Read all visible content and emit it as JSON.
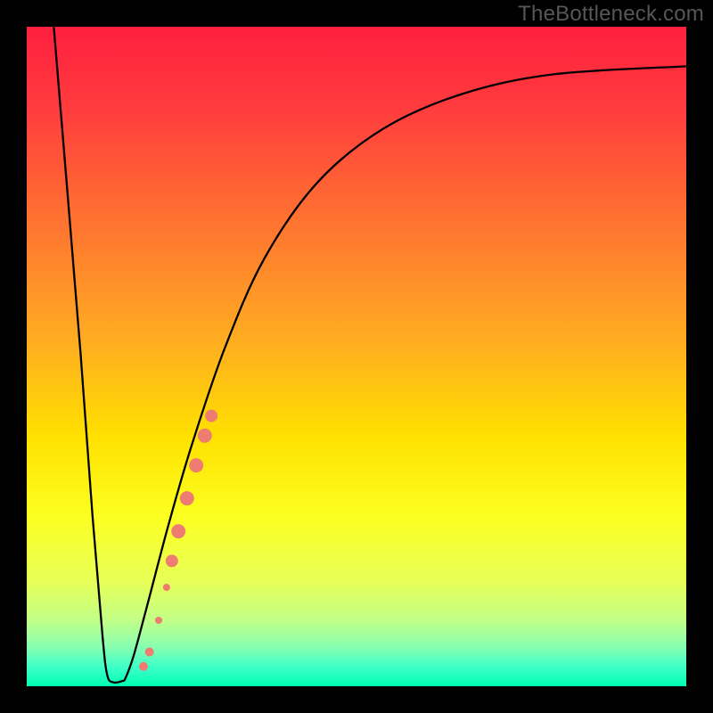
{
  "watermark": "TheBottleneck.com",
  "chart_data": {
    "type": "line",
    "title": "",
    "xlabel": "",
    "ylabel": "",
    "xlim": [
      0,
      100
    ],
    "ylim": [
      0,
      100
    ],
    "grid": false,
    "legend": false,
    "background_gradient_stops": [
      {
        "offset": 0.0,
        "color": "#ff1f3f"
      },
      {
        "offset": 0.12,
        "color": "#ff3b3e"
      },
      {
        "offset": 0.3,
        "color": "#ff7430"
      },
      {
        "offset": 0.48,
        "color": "#ffae20"
      },
      {
        "offset": 0.62,
        "color": "#ffe000"
      },
      {
        "offset": 0.74,
        "color": "#fcff20"
      },
      {
        "offset": 0.84,
        "color": "#e7ff56"
      },
      {
        "offset": 0.9,
        "color": "#c2ff87"
      },
      {
        "offset": 0.94,
        "color": "#88ffb0"
      },
      {
        "offset": 0.97,
        "color": "#40ffc8"
      },
      {
        "offset": 1.0,
        "color": "#00ffb4"
      }
    ],
    "series": [
      {
        "name": "bottleneck-curve",
        "color": "#000000",
        "points": [
          {
            "x": 4.1,
            "y": 100.0
          },
          {
            "x": 8.2,
            "y": 50.0
          },
          {
            "x": 10.0,
            "y": 25.5
          },
          {
            "x": 11.5,
            "y": 7.5
          },
          {
            "x": 12.2,
            "y": 1.7
          },
          {
            "x": 13.1,
            "y": 0.6
          },
          {
            "x": 14.5,
            "y": 0.8
          },
          {
            "x": 15.0,
            "y": 1.3
          },
          {
            "x": 16.2,
            "y": 4.6
          },
          {
            "x": 18.2,
            "y": 12.0
          },
          {
            "x": 21.5,
            "y": 24.5
          },
          {
            "x": 25.0,
            "y": 36.5
          },
          {
            "x": 30.0,
            "y": 51.2
          },
          {
            "x": 36.0,
            "y": 64.8
          },
          {
            "x": 44.0,
            "y": 76.3
          },
          {
            "x": 54.0,
            "y": 84.5
          },
          {
            "x": 66.0,
            "y": 89.8
          },
          {
            "x": 80.0,
            "y": 92.8
          },
          {
            "x": 100.0,
            "y": 94.0
          }
        ]
      }
    ],
    "scatter": {
      "name": "highlight-points",
      "color": "#ef7c70",
      "points": [
        {
          "x": 17.7,
          "y": 3.0,
          "r": 5
        },
        {
          "x": 18.6,
          "y": 5.2,
          "r": 5
        },
        {
          "x": 20.0,
          "y": 10.0,
          "r": 4
        },
        {
          "x": 21.2,
          "y": 15.0,
          "r": 4
        },
        {
          "x": 22.0,
          "y": 19.0,
          "r": 7
        },
        {
          "x": 23.0,
          "y": 23.5,
          "r": 8
        },
        {
          "x": 24.3,
          "y": 28.5,
          "r": 8
        },
        {
          "x": 25.7,
          "y": 33.5,
          "r": 8
        },
        {
          "x": 27.0,
          "y": 38.0,
          "r": 8
        },
        {
          "x": 28.0,
          "y": 41.0,
          "r": 7
        }
      ]
    }
  }
}
